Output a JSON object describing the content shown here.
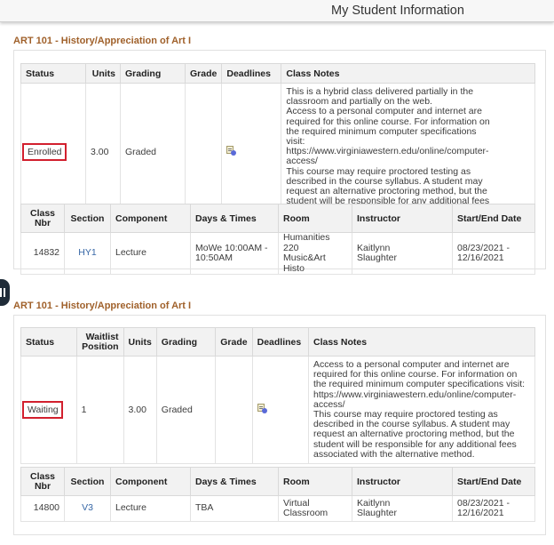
{
  "header": {
    "title": "My Student Information"
  },
  "side_handle": {
    "icon": "pause-bars-icon"
  },
  "courses": [
    {
      "title": "ART 101 - History/Appreciation of Art I",
      "status_table": {
        "headers": {
          "status": "Status",
          "units": "Units",
          "grading": "Grading",
          "grade": "Grade",
          "deadlines": "Deadlines",
          "notes": "Class Notes"
        },
        "row": {
          "status": "Enrolled",
          "units": "3.00",
          "grading": "Graded",
          "grade": "",
          "deadlines_icon": "deadline-calendar-icon",
          "notes": "This is a hybrid class delivered partially in the classroom and partially on the web.\nAccess to a personal computer and internet are required for this online course. For information on the required minimum computer specifications visit: https://www.virginiawestern.edu/online/computer-access/\nThis course may require proctored testing as described in the course syllabus.  A student may request an alternative proctoring method, but the student will be responsible for any additional fees associated with the alternative method."
        }
      },
      "section_table": {
        "headers": {
          "class_nbr_1": "Class",
          "class_nbr_2": "Nbr",
          "section": "Section",
          "component": "Component",
          "days_times": "Days & Times",
          "room": "Room",
          "instructor": "Instructor",
          "dates": "Start/End Date"
        },
        "row": {
          "class_nbr": "14832",
          "section": "HY1",
          "component": "Lecture",
          "days_times_1": "MoWe 10:00AM -",
          "days_times_2": "10:50AM",
          "room_1": "Humanities 220",
          "room_2": "Music&Art Histo",
          "instructor_1": "Kaitlynn",
          "instructor_2": "Slaughter",
          "dates_1": "08/23/2021 -",
          "dates_2": "12/16/2021"
        }
      }
    },
    {
      "title": "ART 101 - History/Appreciation of Art I",
      "status_table": {
        "headers": {
          "status": "Status",
          "waitlist_1": "Waitlist",
          "waitlist_2": "Position",
          "units": "Units",
          "grading": "Grading",
          "grade": "Grade",
          "deadlines": "Deadlines",
          "notes": "Class Notes"
        },
        "row": {
          "status": "Waiting",
          "waitlist_position": "1",
          "units": "3.00",
          "grading": "Graded",
          "grade": "",
          "deadlines_icon": "deadline-calendar-icon",
          "notes": "Access to a personal computer and internet are required for this online course. For information on the required minimum computer specifications visit: https://www.virginiawestern.edu/online/computer-access/\nThis course may require proctored testing as described in the course syllabus.  A student may request an alternative proctoring method, but the student will be responsible for any additional fees associated with the alternative method."
        }
      },
      "section_table": {
        "headers": {
          "class_nbr_1": "Class",
          "class_nbr_2": "Nbr",
          "section": "Section",
          "component": "Component",
          "days_times": "Days & Times",
          "room": "Room",
          "instructor": "Instructor",
          "dates": "Start/End Date"
        },
        "row": {
          "class_nbr": "14800",
          "section": "V3",
          "component": "Lecture",
          "days_times_1": "TBA",
          "days_times_2": "",
          "room_1": "Virtual",
          "room_2": "Classroom",
          "instructor_1": "Kaitlynn",
          "instructor_2": "Slaughter",
          "dates_1": "08/23/2021 -",
          "dates_2": "12/16/2021"
        }
      }
    }
  ],
  "colors": {
    "course_title": "#a0612b",
    "status_highlight": "#d2202e",
    "link": "#3767a6"
  }
}
